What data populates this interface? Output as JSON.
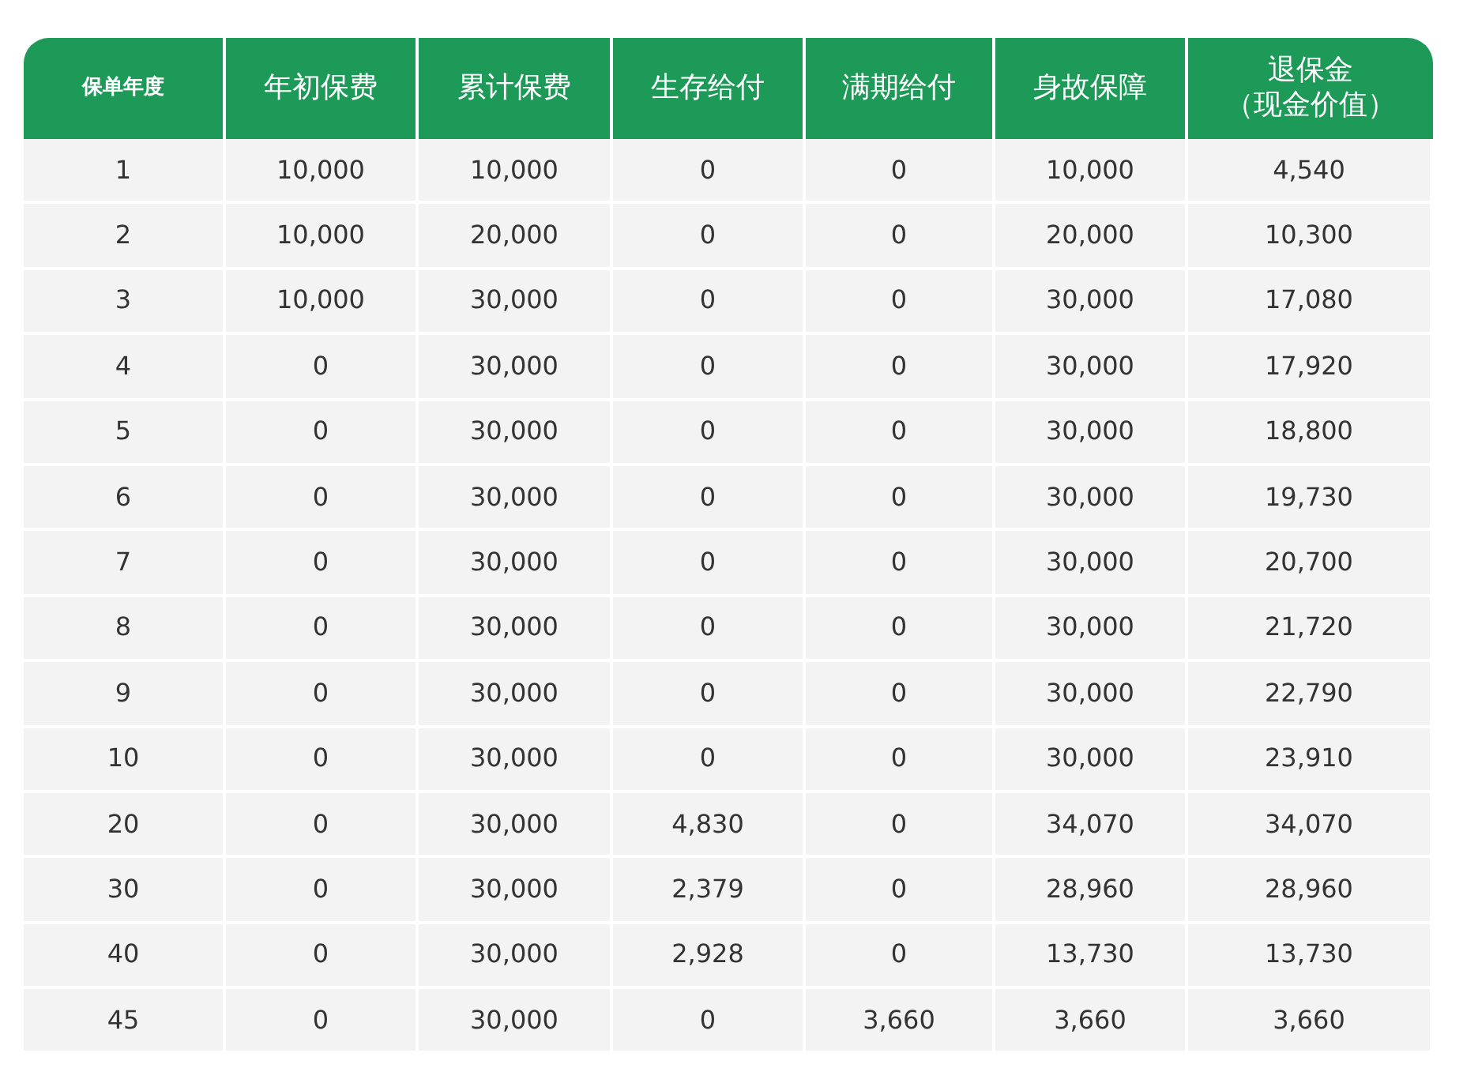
{
  "table": {
    "columns": [
      "保单年度",
      "年初保费",
      "累计保费",
      "生存给付",
      "满期给付",
      "身故保障",
      [
        "退保金",
        "（现金价值）"
      ]
    ],
    "rows": [
      [
        "1",
        "10,000",
        "10,000",
        "0",
        "0",
        "10,000",
        "4,540"
      ],
      [
        "2",
        "10,000",
        "20,000",
        "0",
        "0",
        "20,000",
        "10,300"
      ],
      [
        "3",
        "10,000",
        "30,000",
        "0",
        "0",
        "30,000",
        "17,080"
      ],
      [
        "4",
        "0",
        "30,000",
        "0",
        "0",
        "30,000",
        "17,920"
      ],
      [
        "5",
        "0",
        "30,000",
        "0",
        "0",
        "30,000",
        "18,800"
      ],
      [
        "6",
        "0",
        "30,000",
        "0",
        "0",
        "30,000",
        "19,730"
      ],
      [
        "7",
        "0",
        "30,000",
        "0",
        "0",
        "30,000",
        "20,700"
      ],
      [
        "8",
        "0",
        "30,000",
        "0",
        "0",
        "30,000",
        "21,720"
      ],
      [
        "9",
        "0",
        "30,000",
        "0",
        "0",
        "30,000",
        "22,790"
      ],
      [
        "10",
        "0",
        "30,000",
        "0",
        "0",
        "30,000",
        "23,910"
      ],
      [
        "20",
        "0",
        "30,000",
        "4,830",
        "0",
        "34,070",
        "34,070"
      ],
      [
        "30",
        "0",
        "30,000",
        "2,379",
        "0",
        "28,960",
        "28,960"
      ],
      [
        "40",
        "0",
        "30,000",
        "2,928",
        "0",
        "13,730",
        "13,730"
      ],
      [
        "45",
        "0",
        "30,000",
        "0",
        "3,660",
        "3,660",
        "3,660"
      ]
    ]
  }
}
